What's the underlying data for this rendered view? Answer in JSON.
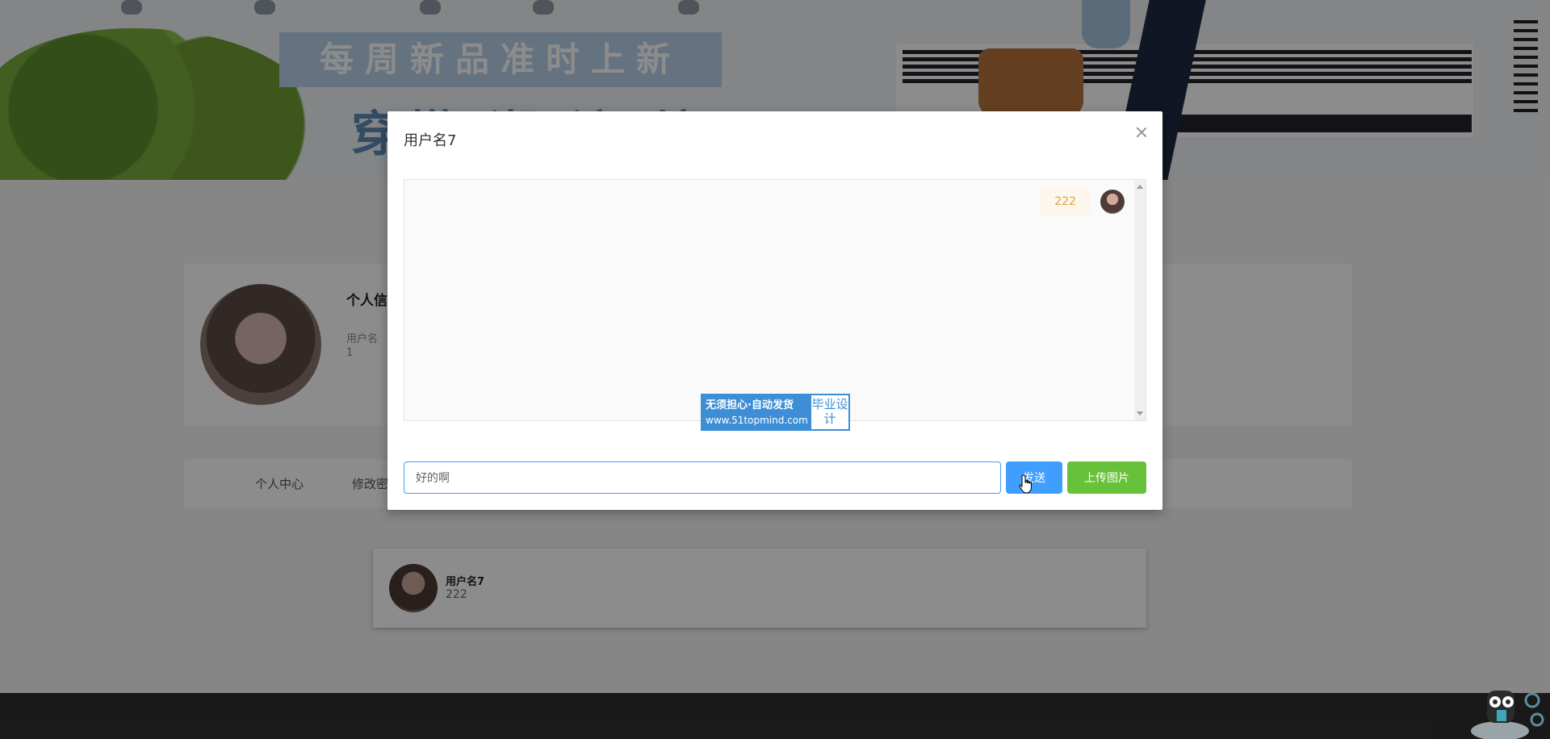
{
  "banner": {
    "slogan": "每周新品准时上新",
    "slogan2": "穿搭 潮 流 坊"
  },
  "profile": {
    "title": "个人信",
    "username_label": "用户名",
    "username_value": "1"
  },
  "tabs": [
    "个人中心",
    "修改密"
  ],
  "chat_list": [
    {
      "name": "用户名7",
      "preview": "222"
    }
  ],
  "dialog": {
    "title": "用户名7",
    "messages": [
      {
        "text": "222",
        "side": "right"
      }
    ],
    "watermark": {
      "line1": "无须担心·自动发货",
      "url": "www.51topmind.com",
      "side_text": "毕业设计"
    },
    "input_value": "好的啊",
    "send_label": "发送",
    "upload_label": "上传图片"
  },
  "colors": {
    "primary": "#409eff",
    "success": "#67c23a",
    "bubble_bg": "#fcf6ed",
    "bubble_text": "#e6a23c",
    "overlay": "rgba(0,0,0,0.45)"
  },
  "icons": {
    "close": "close-icon",
    "scroll_up": "arrow-up-icon",
    "scroll_down": "arrow-down-icon",
    "cursor": "hand-pointer-icon"
  }
}
